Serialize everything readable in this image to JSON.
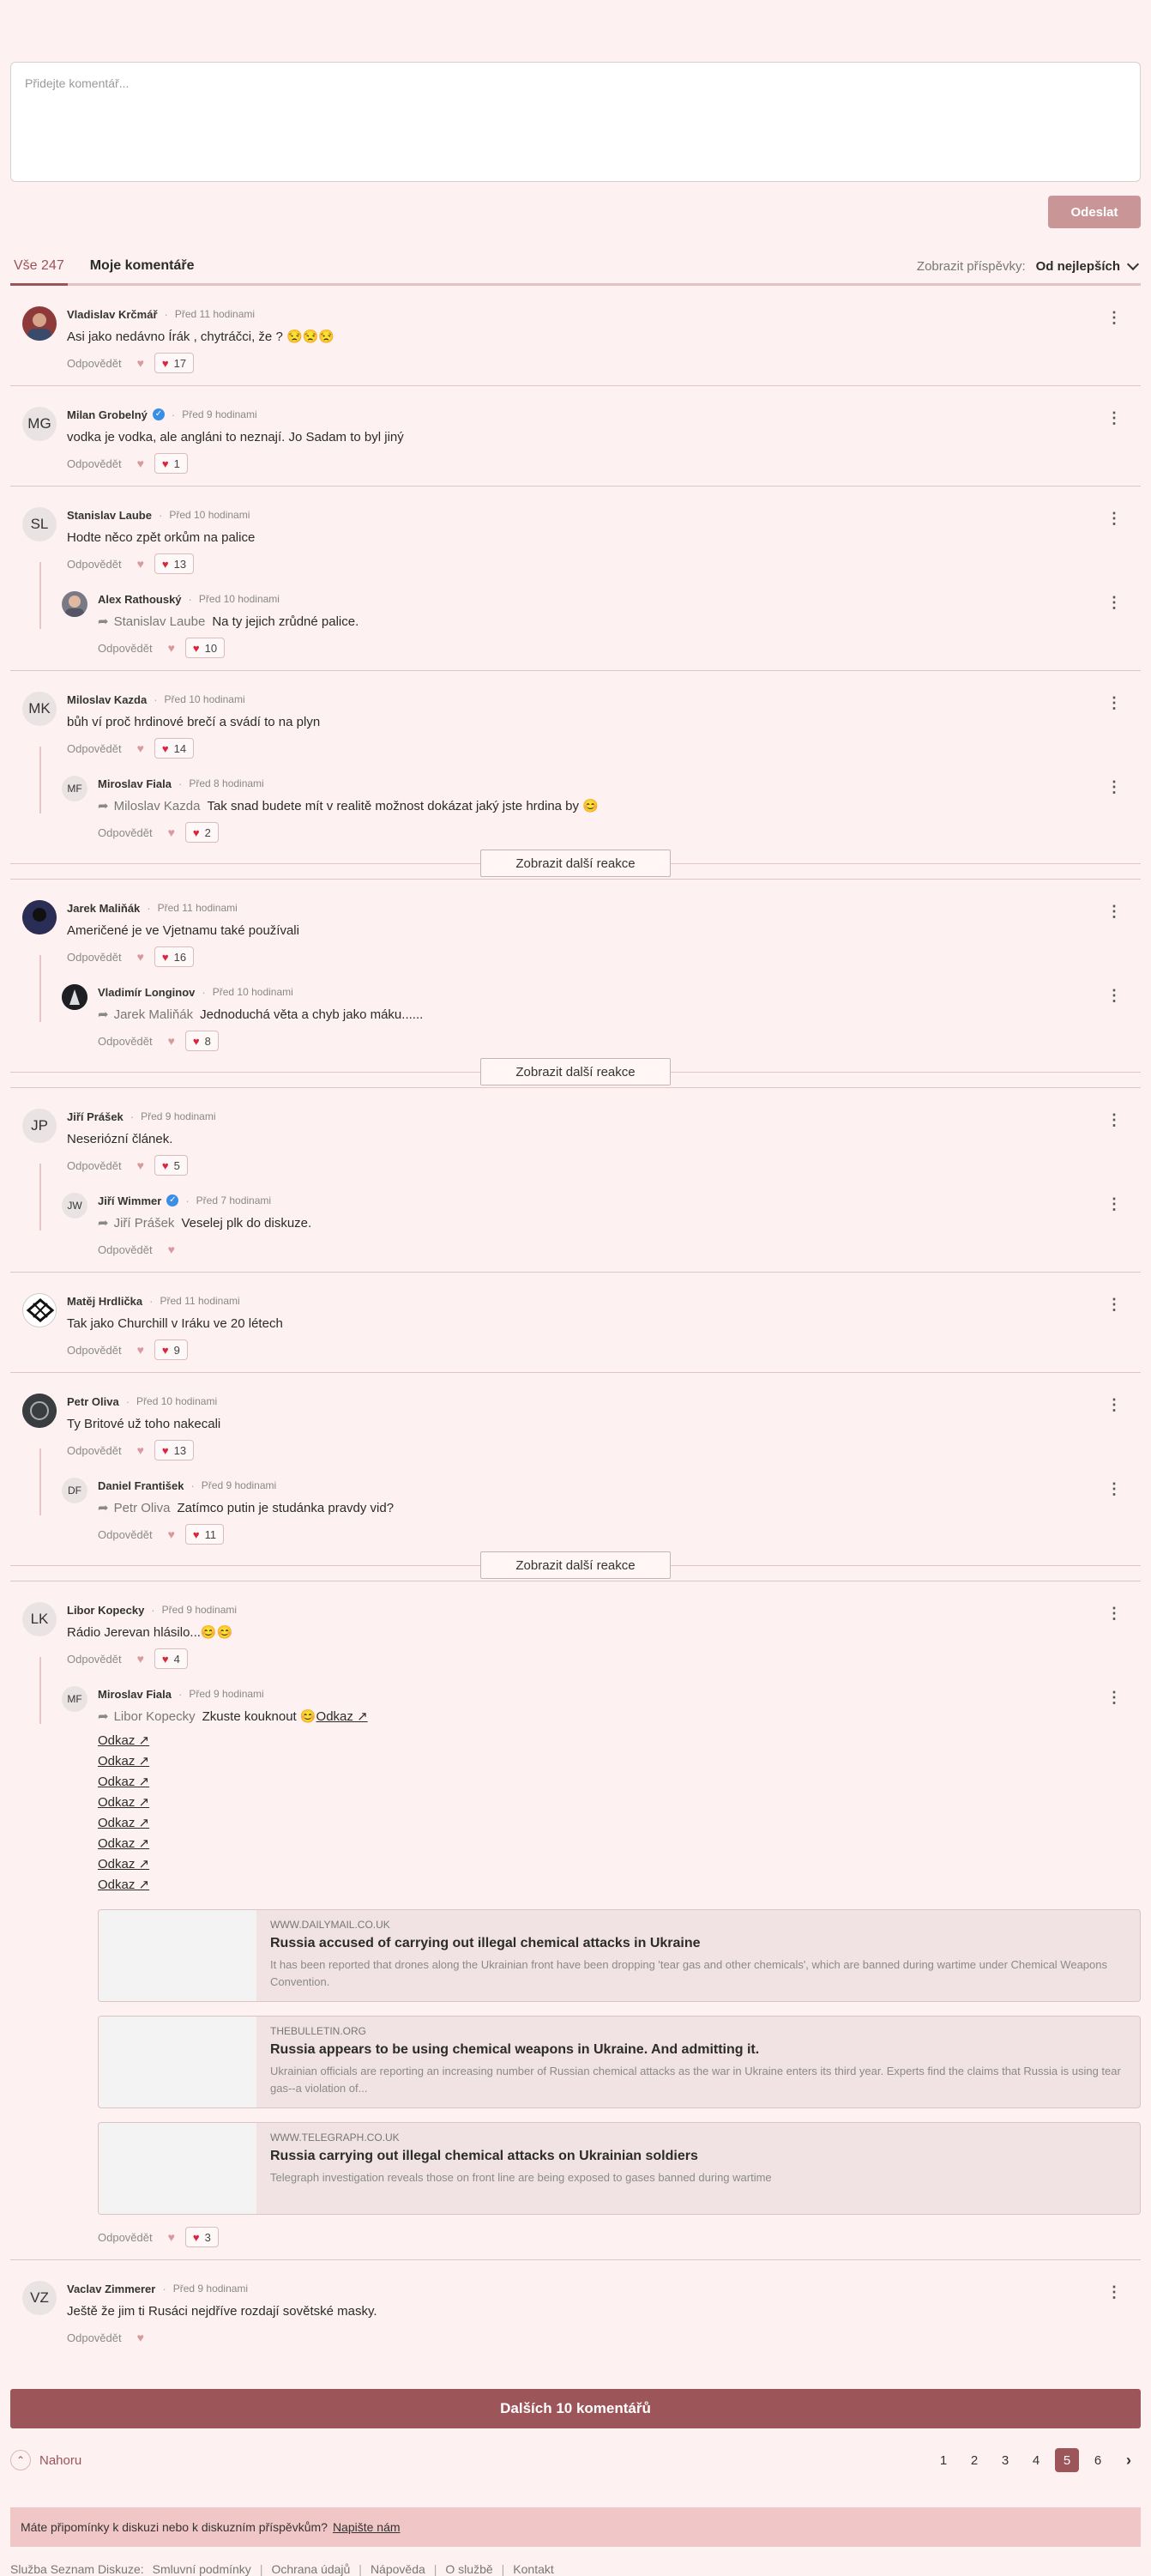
{
  "compose": {
    "placeholder": "Přidejte komentář...",
    "send_label": "Odeslat"
  },
  "tabs": {
    "all_label": "Vše 247",
    "mine_label": "Moje komentáře"
  },
  "sort": {
    "label": "Zobrazit příspěvky:",
    "value": "Od nejlepších"
  },
  "common": {
    "reply_label": "Odpovědět",
    "more_reactions": "Zobrazit další reakce",
    "dot": "·"
  },
  "threads": [
    {
      "name": "Vladislav Krčmář",
      "time": "Před 11 hodinami",
      "text": "Asi jako nedávno Írák , chytráčci, že ? 😒😒😒",
      "count": "17"
    },
    {
      "name": "Milan Grobelný",
      "initials": "MG",
      "time": "Před 9 hodinami",
      "text": "vodka je vodka, ale angláni to neznají. Jo Sadam to byl jiný",
      "count": "1"
    },
    {
      "name": "Stanislav Laube",
      "initials": "SL",
      "time": "Před 10 hodinami",
      "text": "Hodte něco zpět orkům na palice",
      "count": "13",
      "reply": {
        "name": "Alex Rathouský",
        "time": "Před 10 hodinami",
        "to": "Stanislav Laube",
        "text": "Na ty jejich zrůdné palice.",
        "count": "10"
      }
    },
    {
      "name": "Miloslav Kazda",
      "initials": "MK",
      "time": "Před 10 hodinami",
      "text": "bůh ví proč hrdinové brečí a svádí to na plyn",
      "count": "14",
      "reply": {
        "name": "Miroslav Fiala",
        "initials": "MF",
        "time": "Před 8 hodinami",
        "to": "Miloslav Kazda",
        "text": "Tak snad budete mít v realitě možnost dokázat jaký jste hrdina by 😊",
        "count": "2"
      }
    },
    {
      "name": "Jarek Maliňák",
      "time": "Před 11 hodinami",
      "text": "Američené je ve Vjetnamu také používali",
      "count": "16",
      "reply": {
        "name": "Vladimír Longinov",
        "time": "Před 10 hodinami",
        "to": "Jarek Maliňák",
        "text": "Jednoduchá věta a chyb jako máku......",
        "count": "8"
      }
    },
    {
      "name": "Jiří Prášek",
      "initials": "JP",
      "time": "Před 9 hodinami",
      "text": "Neseriózní článek.",
      "count": "5",
      "reply": {
        "name": "Jiří Wimmer",
        "initials": "JW",
        "time": "Před 7 hodinami",
        "to": "Jiří Prášek",
        "text": "Veselej plk do diskuze."
      }
    },
    {
      "name": "Matěj Hrdlička",
      "time": "Před 11 hodinami",
      "text": "Tak jako Churchill v Iráku ve 20 létech",
      "count": "9"
    },
    {
      "name": "Petr Oliva",
      "time": "Před 10 hodinami",
      "text": "Ty Britové už toho nakecali",
      "count": "13",
      "reply": {
        "name": "Daniel František",
        "initials": "DF",
        "time": "Před 9 hodinami",
        "to": "Petr Oliva",
        "text": "Zatímco putin je studánka pravdy vid?",
        "count": "11"
      }
    },
    {
      "name": "Libor Kopecky",
      "initials": "LK",
      "time": "Před 9 hodinami",
      "text": "Rádio Jerevan hlásilo...😊😊",
      "count": "4",
      "reply": {
        "name": "Miroslav Fiala",
        "initials": "MF",
        "time": "Před 9 hodinami",
        "to": "Libor Kopecky",
        "text": "Zkuste kouknout 😊",
        "link": "Odkaz ↗",
        "count": "3"
      }
    },
    {
      "name": "Vaclav Zimmerer",
      "initials": "VZ",
      "time": "Před 9 hodinami",
      "text": "Ještě že jim ti Rusáci nejdříve rozdají sovětské masky."
    }
  ],
  "links": [
    "Odkaz ↗",
    "Odkaz ↗",
    "Odkaz ↗",
    "Odkaz ↗",
    "Odkaz ↗",
    "Odkaz ↗",
    "Odkaz ↗",
    "Odkaz ↗"
  ],
  "cards": [
    {
      "domain": "WWW.DAILYMAIL.CO.UK",
      "title": "Russia accused of carrying out illegal chemical attacks in Ukraine",
      "desc": "It has been reported that drones along the Ukrainian front have been dropping 'tear gas and other chemicals', which are banned during wartime under Chemical Weapons Convention."
    },
    {
      "domain": "THEBULLETIN.ORG",
      "title": "Russia appears to be using chemical weapons in Ukraine. And admitting it.",
      "desc": "Ukrainian officials are reporting an increasing number of Russian chemical attacks as the war in Ukraine enters its third year. Experts find the claims that Russia is using tear gas--a violation of..."
    },
    {
      "domain": "WWW.TELEGRAPH.CO.UK",
      "title": "Russia carrying out illegal chemical attacks on Ukrainian soldiers",
      "desc": "Telegraph investigation reveals those on front line are being exposed to gases banned during wartime"
    }
  ],
  "load_more": "Dalších 10 komentářů",
  "back_top": "Nahoru",
  "pages": [
    "1",
    "2",
    "3",
    "4",
    "5",
    "6"
  ],
  "current_page": "5",
  "notice": {
    "text": "Máte připomínky k diskuzi nebo k diskuzním příspěvkům?",
    "link": "Napište nám"
  },
  "footer": {
    "brand": "Služba Seznam Diskuze:",
    "links": [
      "Smluvní podmínky",
      "Ochrana údajů",
      "Nápověda",
      "O službě",
      "Kontakt"
    ]
  },
  "colors": {
    "accent": "#9c5559",
    "background": "#fdf2f1",
    "heart": "#d9263c"
  }
}
